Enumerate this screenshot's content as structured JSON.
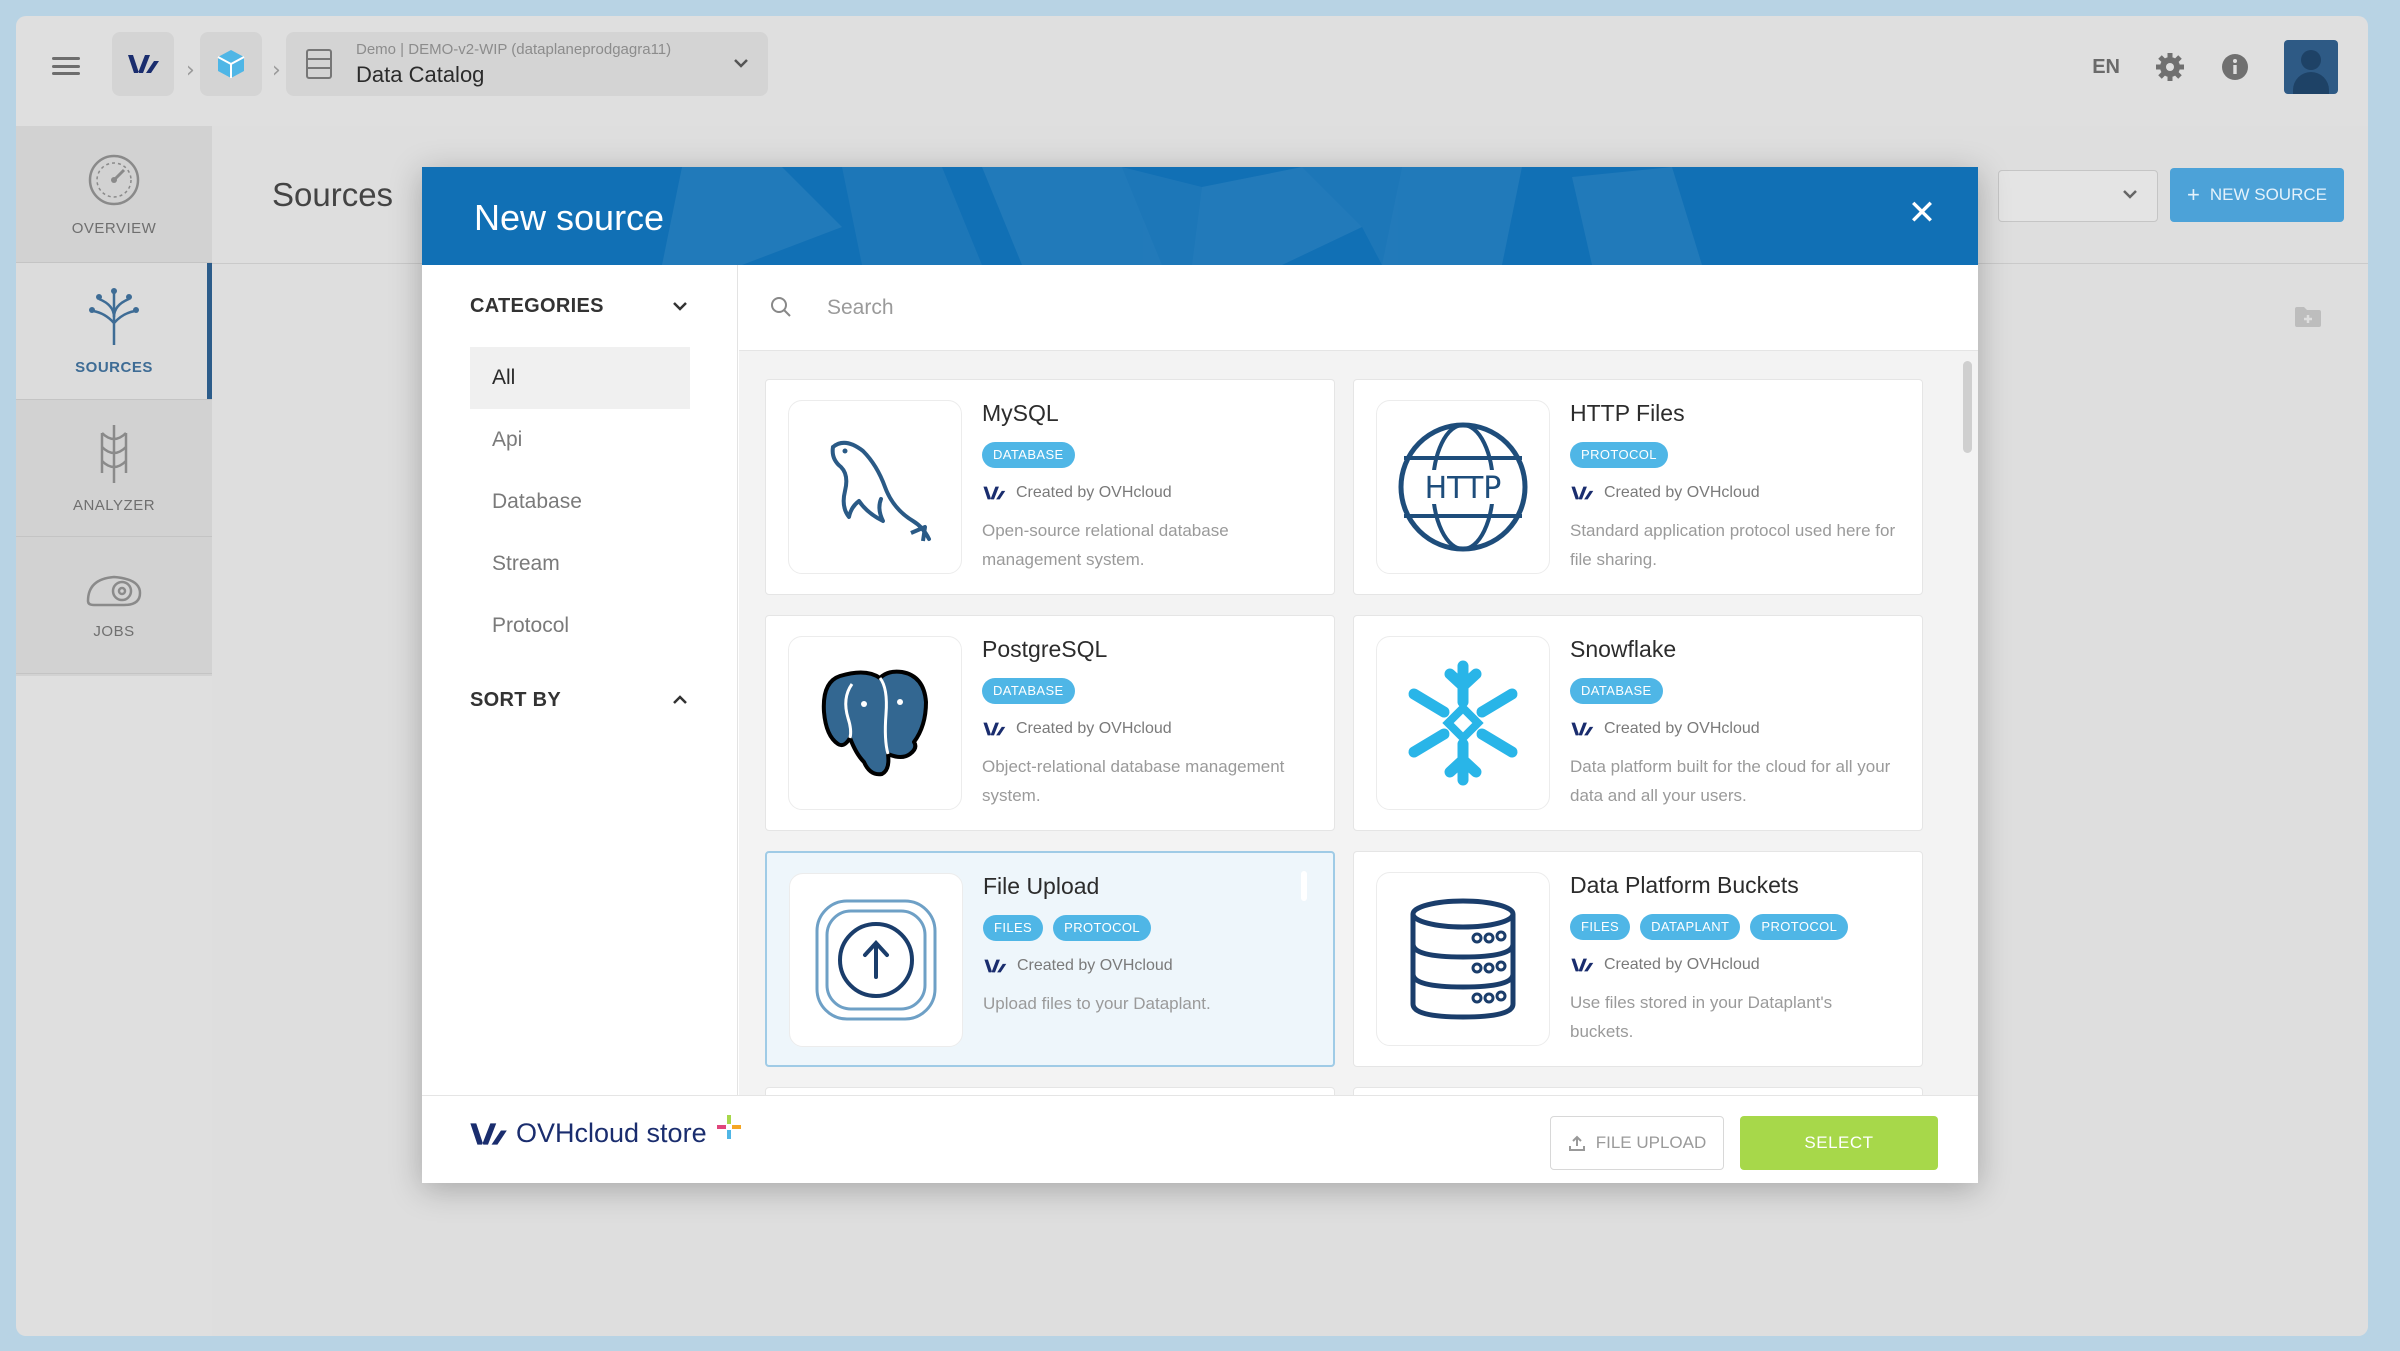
{
  "breadcrumb": {
    "sub": "Demo | DEMO-v2-WIP (dataplaneprodgagra11)",
    "title": "Data Catalog"
  },
  "topbar": {
    "language": "EN"
  },
  "sidenav": {
    "items": [
      {
        "label": "OVERVIEW",
        "icon": "speedometer-icon"
      },
      {
        "label": "SOURCES",
        "icon": "sources-icon"
      },
      {
        "label": "ANALYZER",
        "icon": "analyzer-icon"
      },
      {
        "label": "JOBS",
        "icon": "jobs-icon"
      }
    ]
  },
  "page": {
    "title": "Sources",
    "new_source_label": "NEW SOURCE"
  },
  "modal": {
    "title": "New source",
    "categories_heading": "CATEGORIES",
    "categories": [
      "All",
      "Api",
      "Database",
      "Stream",
      "Protocol"
    ],
    "selected_category": "All",
    "sort_heading": "SORT BY",
    "search_placeholder": "Search",
    "cards": [
      {
        "title": "MySQL",
        "tags": [
          "DATABASE"
        ],
        "creator": "Created by OVHcloud",
        "desc": "Open-source relational database management system."
      },
      {
        "title": "HTTP Files",
        "tags": [
          "PROTOCOL"
        ],
        "creator": "Created by OVHcloud",
        "desc": "Standard application protocol used here for file sharing."
      },
      {
        "title": "PostgreSQL",
        "tags": [
          "DATABASE"
        ],
        "creator": "Created by OVHcloud",
        "desc": "Object-relational database management system."
      },
      {
        "title": "Snowflake",
        "tags": [
          "DATABASE"
        ],
        "creator": "Created by OVHcloud",
        "desc": "Data platform built for the cloud for all your data and all your users."
      },
      {
        "title": "File Upload",
        "tags": [
          "FILES",
          "PROTOCOL"
        ],
        "creator": "Created by OVHcloud",
        "desc": "Upload files to your Dataplant."
      },
      {
        "title": "Data Platform Buckets",
        "tags": [
          "FILES",
          "DATAPLANT",
          "PROTOCOL"
        ],
        "creator": "Created by OVHcloud",
        "desc": "Use files stored in your Dataplant's buckets."
      }
    ],
    "footer": {
      "store_label": "OVHcloud store",
      "file_upload_label": "FILE UPLOAD",
      "select_label": "SELECT"
    }
  },
  "colors": {
    "brand_blue": "#1170b5",
    "tag_blue": "#4fb6e6",
    "select_green": "#a7d84a",
    "ovh_navy": "#1a2d6e"
  }
}
